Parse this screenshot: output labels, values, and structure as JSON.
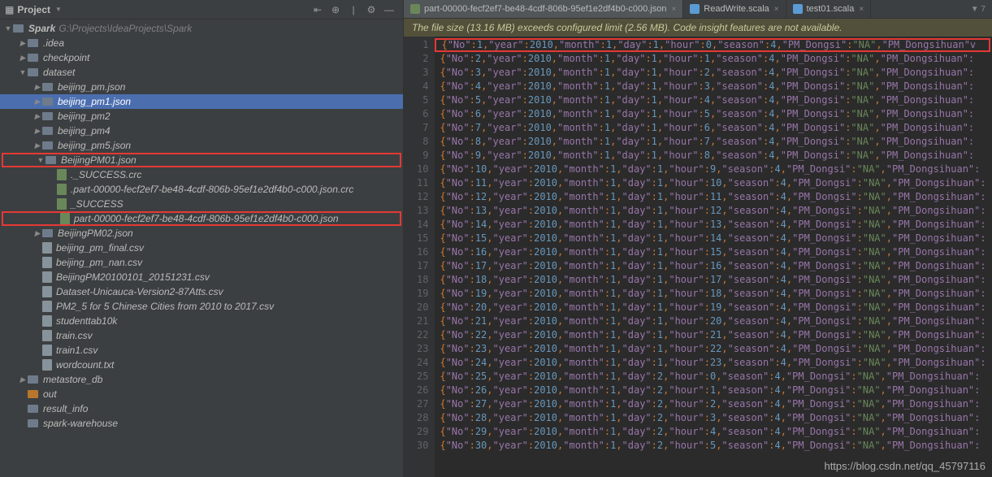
{
  "panel": {
    "title": "Project"
  },
  "tree": {
    "root": {
      "label": "Spark",
      "path": "G:\\Projects\\IdeaProjects\\Spark"
    },
    "items": [
      {
        "indent": 1,
        "arrow": "▶",
        "icon": "folder-gray",
        "label": ".idea"
      },
      {
        "indent": 1,
        "arrow": "▶",
        "icon": "folder-gray",
        "label": "checkpoint"
      },
      {
        "indent": 1,
        "arrow": "▼",
        "icon": "folder-gray",
        "label": "dataset"
      },
      {
        "indent": 2,
        "arrow": "▶",
        "icon": "folder-gray",
        "label": "beijing_pm.json"
      },
      {
        "indent": 2,
        "arrow": "▶",
        "icon": "folder-gray",
        "label": "beijing_pm1.json",
        "selected": true
      },
      {
        "indent": 2,
        "arrow": "▶",
        "icon": "folder-gray",
        "label": "beijing_pm2"
      },
      {
        "indent": 2,
        "arrow": "▶",
        "icon": "folder-gray",
        "label": "beijing_pm4"
      },
      {
        "indent": 2,
        "arrow": "▶",
        "icon": "folder-gray",
        "label": "beijing_pm5.json"
      },
      {
        "indent": 2,
        "arrow": "▼",
        "icon": "folder-gray",
        "label": "BeijingPM01.json",
        "boxed": true
      },
      {
        "indent": 3,
        "arrow": "",
        "icon": "json-icon",
        "label": "._SUCCESS.crc"
      },
      {
        "indent": 3,
        "arrow": "",
        "icon": "json-icon",
        "label": ".part-00000-fecf2ef7-be48-4cdf-806b-95ef1e2df4b0-c000.json.crc"
      },
      {
        "indent": 3,
        "arrow": "",
        "icon": "json-icon",
        "label": "_SUCCESS"
      },
      {
        "indent": 3,
        "arrow": "",
        "icon": "json-icon",
        "label": "part-00000-fecf2ef7-be48-4cdf-806b-95ef1e2df4b0-c000.json",
        "boxed": true
      },
      {
        "indent": 2,
        "arrow": "▶",
        "icon": "folder-gray",
        "label": "BeijingPM02.json"
      },
      {
        "indent": 2,
        "arrow": "",
        "icon": "file-icon",
        "label": "beijing_pm_final.csv"
      },
      {
        "indent": 2,
        "arrow": "",
        "icon": "file-icon",
        "label": "beijing_pm_nan.csv"
      },
      {
        "indent": 2,
        "arrow": "",
        "icon": "file-icon",
        "label": "BeijingPM20100101_20151231.csv"
      },
      {
        "indent": 2,
        "arrow": "",
        "icon": "file-icon",
        "label": "Dataset-Unicauca-Version2-87Atts.csv"
      },
      {
        "indent": 2,
        "arrow": "",
        "icon": "file-icon",
        "label": "PM2_5 for 5 Chinese Cities from 2010 to 2017.csv"
      },
      {
        "indent": 2,
        "arrow": "",
        "icon": "file-icon",
        "label": "studenttab10k"
      },
      {
        "indent": 2,
        "arrow": "",
        "icon": "file-icon",
        "label": "train.csv"
      },
      {
        "indent": 2,
        "arrow": "",
        "icon": "file-icon",
        "label": "train1.csv"
      },
      {
        "indent": 2,
        "arrow": "",
        "icon": "file-icon",
        "label": "wordcount.txt"
      },
      {
        "indent": 1,
        "arrow": "▶",
        "icon": "folder-gray",
        "label": "metastore_db"
      },
      {
        "indent": 1,
        "arrow": "",
        "icon": "folder-orange",
        "label": "out"
      },
      {
        "indent": 1,
        "arrow": "",
        "icon": "folder-gray",
        "label": "result_info"
      },
      {
        "indent": 1,
        "arrow": "",
        "icon": "folder-gray",
        "label": "spark-warehouse"
      }
    ]
  },
  "tabs": [
    {
      "label": "part-00000-fecf2ef7-be48-4cdf-806b-95ef1e2df4b0-c000.json",
      "icon": "json",
      "active": true
    },
    {
      "label": "ReadWrite.scala",
      "icon": "scala"
    },
    {
      "label": "test01.scala",
      "icon": "scala"
    }
  ],
  "tabCount": "▼ 7",
  "warning": "The file size (13.16 MB) exceeds configured limit (2.56 MB). Code insight features are not available.",
  "code": {
    "year": 2010,
    "month": 1,
    "day": 1,
    "season": 4,
    "pm_dongsi": "NA",
    "key6": "PM_Dongsihuan",
    "key6b": "PM_Dongsihuan\"",
    "lines": [
      {
        "no": 1,
        "day": 1,
        "hour": 0,
        "boxed": true,
        "suffix": "v"
      },
      {
        "no": 2,
        "day": 1,
        "hour": 1
      },
      {
        "no": 3,
        "day": 1,
        "hour": 2
      },
      {
        "no": 4,
        "day": 1,
        "hour": 3
      },
      {
        "no": 5,
        "day": 1,
        "hour": 4
      },
      {
        "no": 6,
        "day": 1,
        "hour": 5
      },
      {
        "no": 7,
        "day": 1,
        "hour": 6
      },
      {
        "no": 8,
        "day": 1,
        "hour": 7
      },
      {
        "no": 9,
        "day": 1,
        "hour": 8
      },
      {
        "no": 10,
        "day": 1,
        "hour": 9
      },
      {
        "no": 11,
        "day": 1,
        "hour": 10
      },
      {
        "no": 12,
        "day": 1,
        "hour": 11
      },
      {
        "no": 13,
        "day": 1,
        "hour": 12
      },
      {
        "no": 14,
        "day": 1,
        "hour": 13
      },
      {
        "no": 15,
        "day": 1,
        "hour": 14
      },
      {
        "no": 16,
        "day": 1,
        "hour": 15
      },
      {
        "no": 17,
        "day": 1,
        "hour": 16
      },
      {
        "no": 18,
        "day": 1,
        "hour": 17
      },
      {
        "no": 19,
        "day": 1,
        "hour": 18
      },
      {
        "no": 20,
        "day": 1,
        "hour": 19
      },
      {
        "no": 21,
        "day": 1,
        "hour": 20
      },
      {
        "no": 22,
        "day": 1,
        "hour": 21
      },
      {
        "no": 23,
        "day": 1,
        "hour": 22
      },
      {
        "no": 24,
        "day": 1,
        "hour": 23
      },
      {
        "no": 25,
        "day": 2,
        "hour": 0
      },
      {
        "no": 26,
        "day": 2,
        "hour": 1
      },
      {
        "no": 27,
        "day": 2,
        "hour": 2
      },
      {
        "no": 28,
        "day": 2,
        "hour": 3
      },
      {
        "no": 29,
        "day": 2,
        "hour": 4
      },
      {
        "no": 30,
        "day": 2,
        "hour": 5
      }
    ]
  },
  "watermark": "https://blog.csdn.net/qq_45797116"
}
